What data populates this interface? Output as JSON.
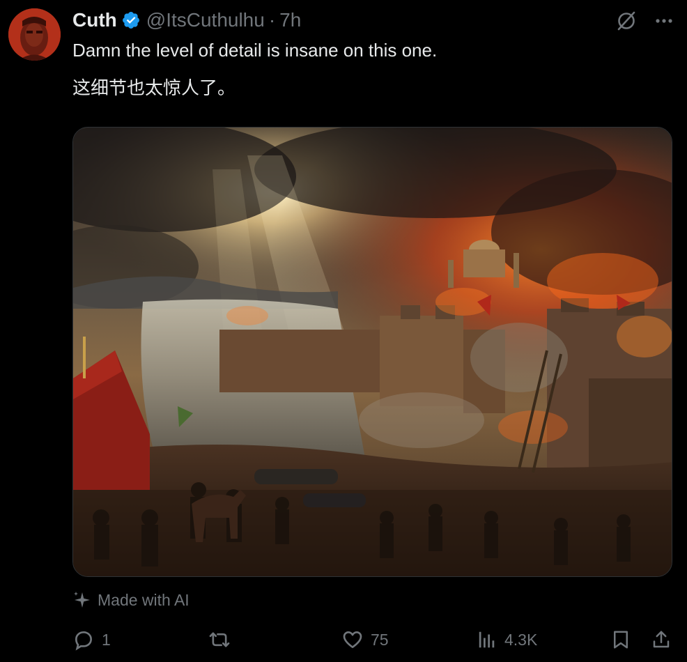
{
  "author": {
    "display_name": "Cuth",
    "handle": "@ItsCuthulhu",
    "separator": "·",
    "timestamp": "7h",
    "verified": true
  },
  "tweet": {
    "text_line1": "Damn the level of detail is insane on this one.",
    "text_line2": "这细节也太惊人了。"
  },
  "media": {
    "alt": "Painting-style image of a burning walled city under siege beside a harbor"
  },
  "ai_badge": {
    "label": "Made with AI",
    "icon": "sparkle-icon"
  },
  "actions": {
    "reply_count": "1",
    "retweet_count": "",
    "like_count": "75",
    "views_count": "4.3K"
  },
  "icons": {
    "grok": "slash-circle-icon",
    "more": "more-dots-icon",
    "reply": "reply-icon",
    "retweet": "retweet-icon",
    "like": "heart-icon",
    "views": "views-icon",
    "bookmark": "bookmark-icon",
    "share": "share-icon"
  },
  "colors": {
    "background": "#000000",
    "text_primary": "#e7e9ea",
    "text_secondary": "#71767b",
    "verified_blue": "#1d9bf0"
  }
}
